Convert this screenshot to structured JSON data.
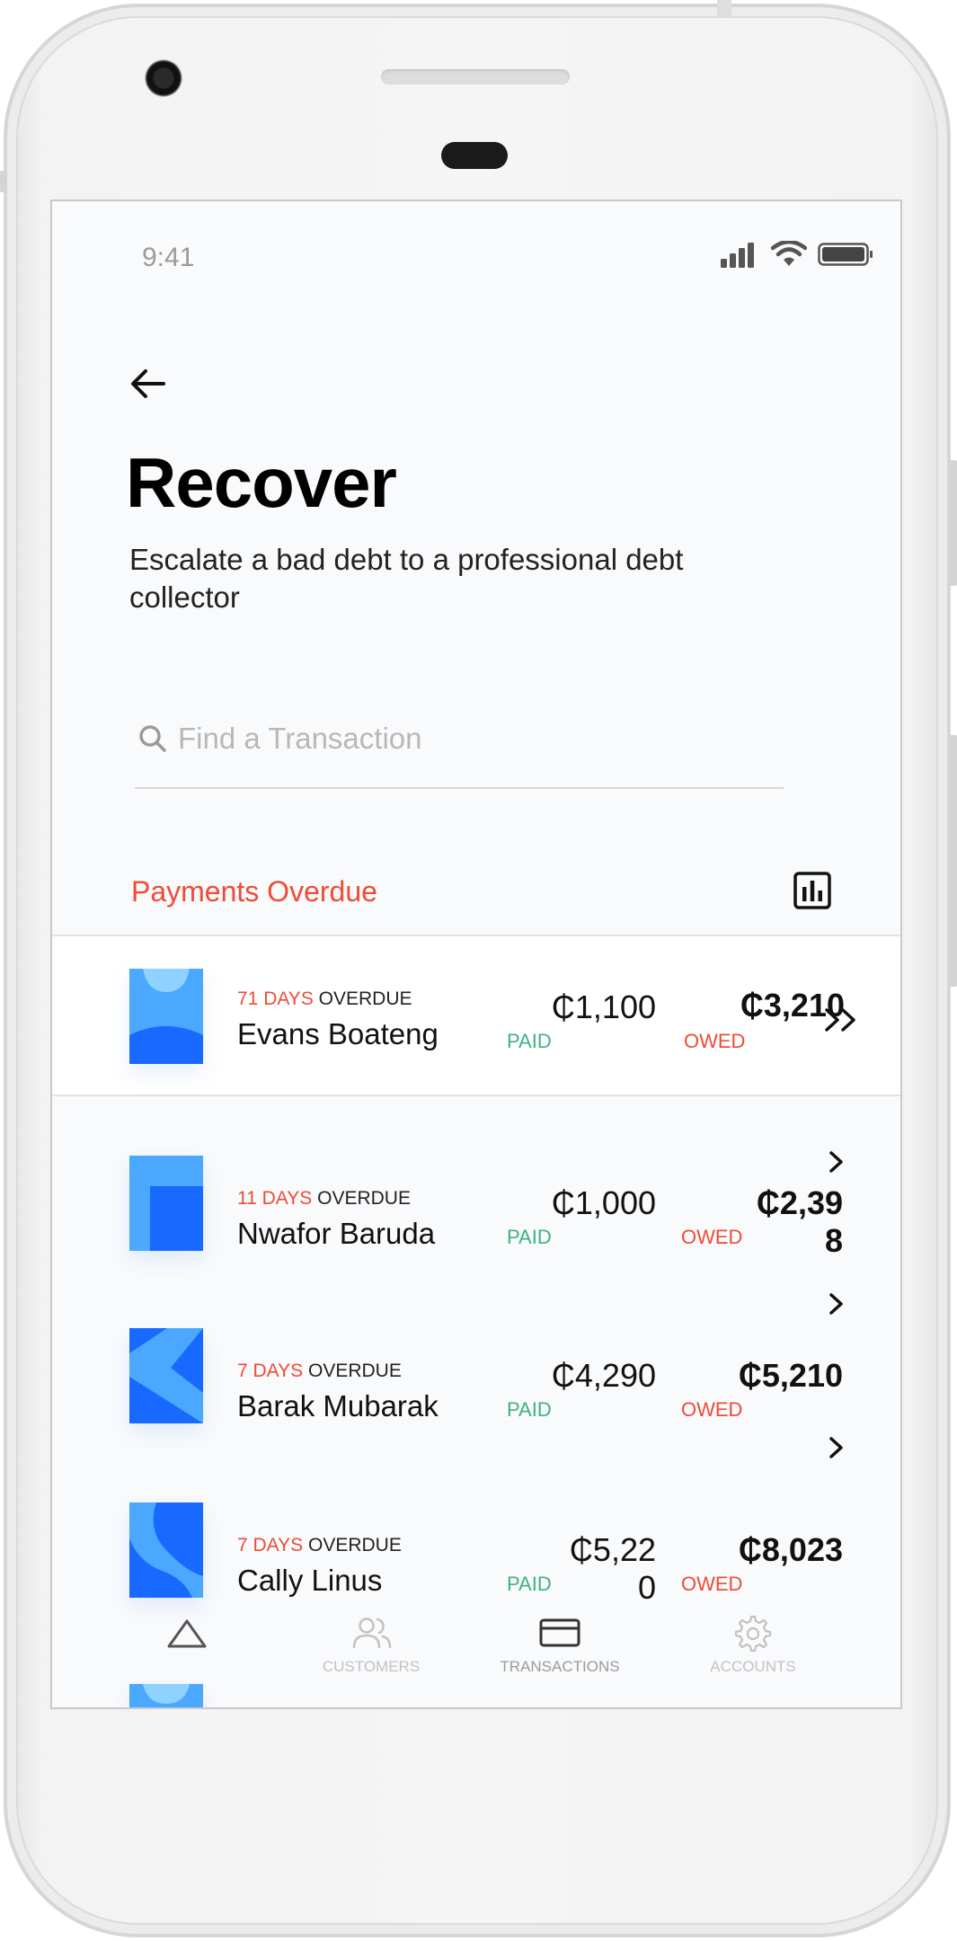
{
  "status_bar": {
    "time": "9:41"
  },
  "header": {
    "title": "Recover",
    "subtitle": "Escalate a bad debt to a professional debt collector"
  },
  "search": {
    "placeholder": "Find a Transaction"
  },
  "section": {
    "title": "Payments Overdue",
    "icon": "bar-chart-icon"
  },
  "transactions": [
    {
      "days": "71 DAYS",
      "overdue_label": "OVERDUE",
      "name": "Evans Boateng",
      "paid": "₵1,100",
      "paid_label": "PAID",
      "owed": "₵3,210",
      "owed_label": "OWED"
    },
    {
      "days": "11 DAYS",
      "overdue_label": "OVERDUE",
      "name": "Nwafor Baruda",
      "paid": "₵1,000",
      "paid_label": "PAID",
      "owed": "₵2,39",
      "owed_wrap": "8",
      "owed_label": "OWED"
    },
    {
      "days": "7 DAYS",
      "overdue_label": "OVERDUE",
      "name": "Barak Mubarak",
      "paid": "₵4,290",
      "paid_label": "PAID",
      "owed": "₵5,210",
      "owed_label": "OWED"
    },
    {
      "days": "7 DAYS",
      "overdue_label": "OVERDUE",
      "name": "Cally Linus",
      "paid": "₵5,22",
      "paid_wrap": "0",
      "paid_label": "PAID",
      "owed": "₵8,023",
      "owed_label": "OWED"
    }
  ],
  "tabs": [
    {
      "label": "",
      "icon": "home-triangle-icon",
      "active": true
    },
    {
      "label": "CUSTOMERS",
      "icon": "users-icon"
    },
    {
      "label": "TRANSACTIONS",
      "icon": "card-icon"
    },
    {
      "label": "ACCOUNTS",
      "icon": "gear-icon"
    }
  ],
  "colors": {
    "accent_red": "#ef4b35",
    "paid_green": "#3fb27f",
    "avatar_blue": "#1769ff",
    "avatar_light_blue": "#4aa8ff",
    "screen_bg": "#f9fafc"
  }
}
